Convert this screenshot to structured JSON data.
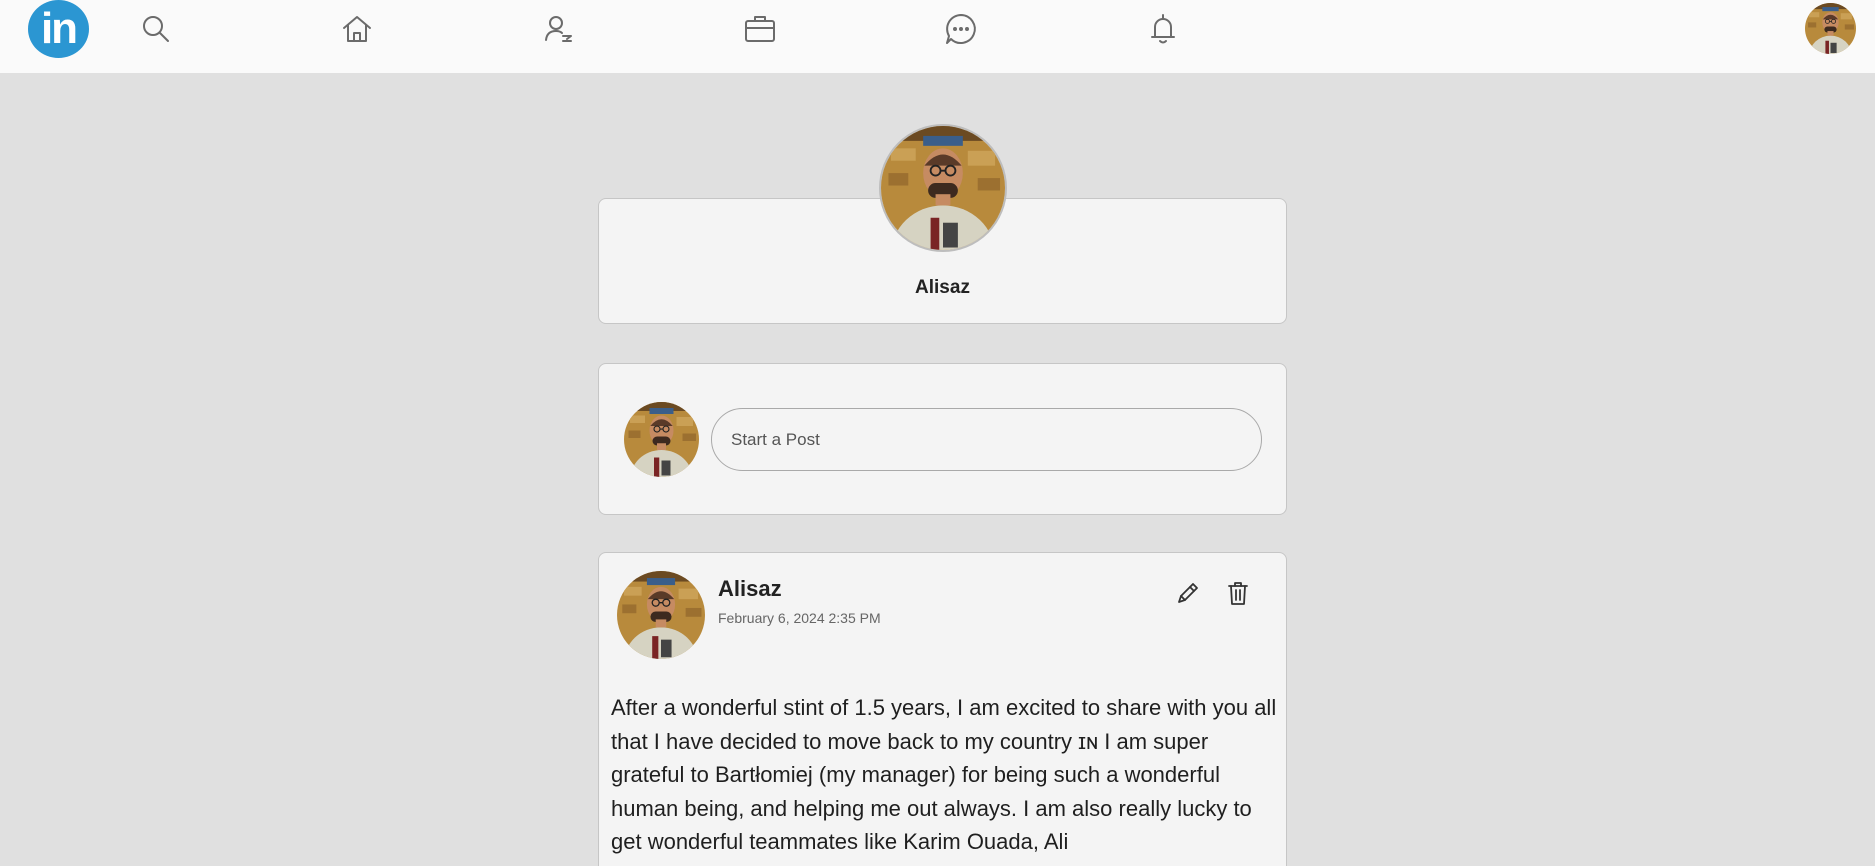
{
  "nav": {
    "logo_text": "in",
    "icons": [
      "search-icon",
      "home-icon",
      "network-icon",
      "jobs-icon",
      "messaging-icon",
      "notifications-icon"
    ]
  },
  "profile": {
    "name": "Alisaz"
  },
  "composer": {
    "placeholder": "Start a Post"
  },
  "post": {
    "author": "Alisaz",
    "date": "February 6, 2024 2:35 PM",
    "text": "After a wonderful stint of 1.5 years, I am excited to share with you all that I have decided to move back to my country ɪɴ I am super grateful to Bartłomiej (my manager) for being such a wonderful human being, and helping me out always. I am also really lucky to get wonderful teammates like Karim Ouada, Ali"
  },
  "colors": {
    "brand": "#2b96d2",
    "background": "#e0e0e0",
    "card": "#f4f4f4"
  }
}
